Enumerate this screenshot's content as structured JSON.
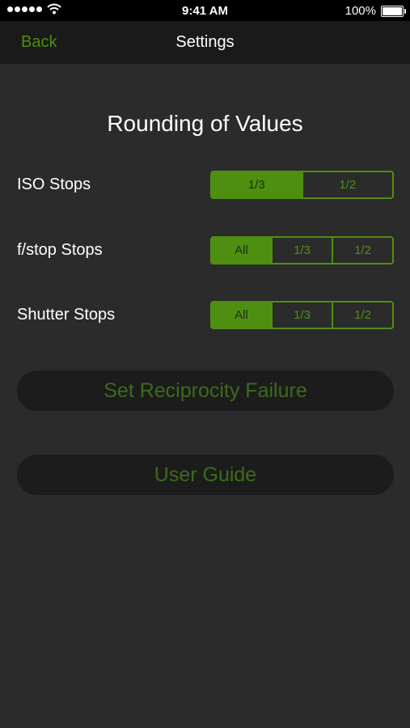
{
  "status_bar": {
    "time": "9:41 AM",
    "battery": "100%",
    "signal_icon": "signal-dots-icon",
    "wifi_icon": "wifi-icon",
    "battery_icon": "battery-icon"
  },
  "nav": {
    "back_label": "Back",
    "title": "Settings"
  },
  "section_title": "Rounding of Values",
  "rows": [
    {
      "label": "ISO Stops",
      "options": [
        "1/3",
        "1/2"
      ],
      "selected": "1/3"
    },
    {
      "label": "f/stop Stops",
      "options": [
        "All",
        "1/3",
        "1/2"
      ],
      "selected": "All"
    },
    {
      "label": "Shutter Stops",
      "options": [
        "All",
        "1/3",
        "1/2"
      ],
      "selected": "All"
    }
  ],
  "buttons": {
    "reciprocity": "Set Reciprocity Failure",
    "user_guide": "User Guide"
  },
  "colors": {
    "accent": "#4e8f12",
    "background": "#2b2b2b",
    "nav_background": "#1a1a1a",
    "button_background": "#1c1c1c",
    "button_text": "#3e6b18"
  }
}
